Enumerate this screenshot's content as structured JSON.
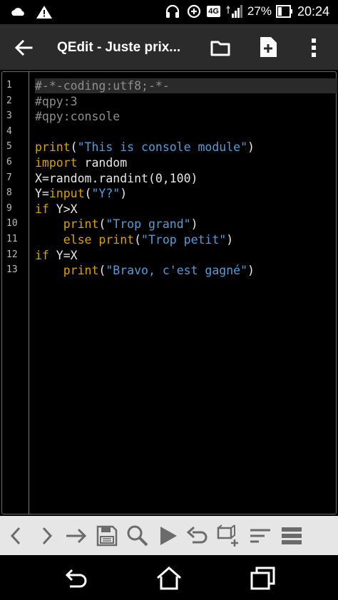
{
  "status_bar": {
    "network_badge": "4G",
    "battery_percent": "27%",
    "time": "20:24",
    "icons": [
      "cloud-icon",
      "warning-icon",
      "headset-icon",
      "data-saver-icon",
      "signal-icon",
      "battery-icon"
    ]
  },
  "app_bar": {
    "title": "QEdit - Juste prix...",
    "actions": [
      "back-arrow-icon",
      "folder-icon",
      "new-file-icon",
      "overflow-menu-icon"
    ]
  },
  "editor": {
    "line_numbers": [
      "1",
      "2",
      "3",
      "4",
      "5",
      "6",
      "7",
      "8",
      "9",
      "10",
      "11",
      "12",
      "13"
    ],
    "lines": [
      [
        {
          "t": "comment",
          "v": "#-*-coding:utf8;-*-"
        }
      ],
      [
        {
          "t": "comment",
          "v": "#qpy:3"
        }
      ],
      [
        {
          "t": "comment",
          "v": "#qpy:console"
        }
      ],
      [],
      [
        {
          "t": "kw",
          "v": "print"
        },
        {
          "t": "plain",
          "v": "("
        },
        {
          "t": "str",
          "v": "\"This is console module\""
        },
        {
          "t": "plain",
          "v": ")"
        }
      ],
      [
        {
          "t": "kw",
          "v": "import"
        },
        {
          "t": "plain",
          "v": " random"
        }
      ],
      [
        {
          "t": "plain",
          "v": "X=random.randint(0,100)"
        }
      ],
      [
        {
          "t": "plain",
          "v": "Y="
        },
        {
          "t": "kw",
          "v": "input"
        },
        {
          "t": "plain",
          "v": "("
        },
        {
          "t": "str",
          "v": "\"Y?\""
        },
        {
          "t": "plain",
          "v": ")"
        }
      ],
      [
        {
          "t": "kw",
          "v": "if"
        },
        {
          "t": "plain",
          "v": " Y>X"
        }
      ],
      [
        {
          "t": "plain",
          "v": "    "
        },
        {
          "t": "kw",
          "v": "print"
        },
        {
          "t": "plain",
          "v": "("
        },
        {
          "t": "str",
          "v": "\"Trop grand\""
        },
        {
          "t": "plain",
          "v": ")"
        }
      ],
      [
        {
          "t": "plain",
          "v": "    "
        },
        {
          "t": "kw",
          "v": "else print"
        },
        {
          "t": "plain",
          "v": "("
        },
        {
          "t": "str",
          "v": "\"Trop petit\""
        },
        {
          "t": "plain",
          "v": ")"
        }
      ],
      [
        {
          "t": "kw",
          "v": "if"
        },
        {
          "t": "plain",
          "v": " Y=X"
        }
      ],
      [
        {
          "t": "plain",
          "v": "    "
        },
        {
          "t": "kw",
          "v": "print"
        },
        {
          "t": "plain",
          "v": "("
        },
        {
          "t": "str",
          "v": "\"Bravo, c'est gagné\""
        },
        {
          "t": "plain",
          "v": ")"
        }
      ]
    ]
  },
  "toolbar": {
    "buttons": [
      "cursor-left-icon",
      "cursor-right-icon",
      "goto-line-icon",
      "save-icon",
      "search-icon",
      "run-icon",
      "undo-icon",
      "snippet-icon",
      "indent-icon",
      "format-icon"
    ]
  },
  "nav_bar": {
    "buttons": [
      "nav-back-icon",
      "nav-home-icon",
      "nav-recents-icon"
    ]
  },
  "colors": {
    "comment": "#8e8e8e",
    "keyword": "#d5a20b",
    "string": "#5a9bd6",
    "plain": "#e8e8e8",
    "app_bar": "#2b2b2b",
    "toolbar": "#e6e6e6"
  }
}
